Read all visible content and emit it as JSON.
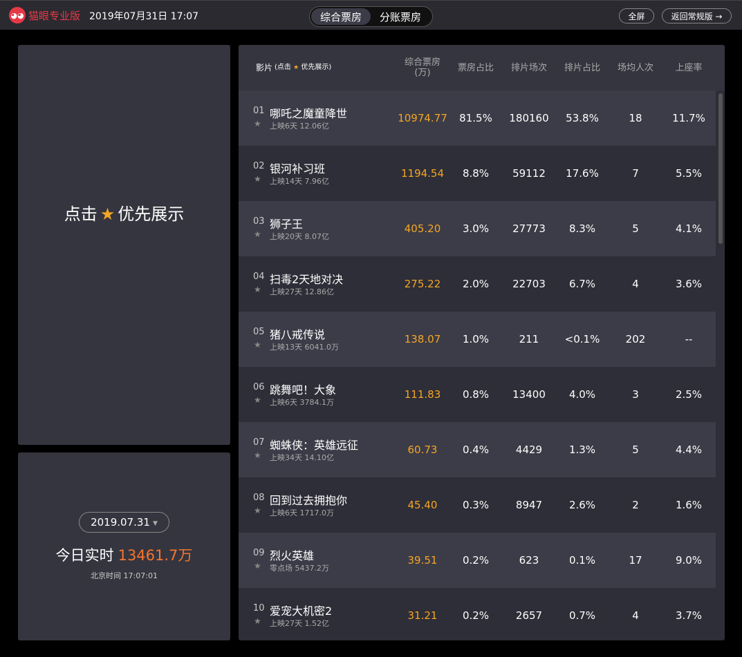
{
  "topbar": {
    "logo_text": "猫眼专业版",
    "datetime": "2019年07月31日 17:07",
    "tabs": [
      {
        "label": "综合票房",
        "active": true
      },
      {
        "label": "分账票房",
        "active": false
      }
    ],
    "fullscreen_label": "全屏",
    "return_label": "返回常规版 →"
  },
  "priority_panel": {
    "prefix": "点击",
    "suffix": "优先展示"
  },
  "summary": {
    "date": "2019.07.31",
    "today_label": "今日实时",
    "today_amount": "13461.7万",
    "beijing_time": "北京时间 17:07:01"
  },
  "table": {
    "headers": {
      "film": "影片",
      "film_hint_prefix": "(点击",
      "film_hint_suffix": "优先展示)",
      "box_line1": "综合票房",
      "box_line2": "(万)",
      "box_share": "票房占比",
      "shows": "排片场次",
      "show_share": "排片占比",
      "avg_viewers": "场均人次",
      "occupancy": "上座率"
    },
    "rows": [
      {
        "rank": "01",
        "name": "哪吒之魔童降世",
        "meta": "上映6天  12.06亿",
        "box": "10974.77",
        "box_share": "81.5%",
        "shows": "180160",
        "show_share": "53.8%",
        "avg": "18",
        "occ": "11.7%"
      },
      {
        "rank": "02",
        "name": "银河补习班",
        "meta": "上映14天  7.96亿",
        "box": "1194.54",
        "box_share": "8.8%",
        "shows": "59112",
        "show_share": "17.6%",
        "avg": "7",
        "occ": "5.5%"
      },
      {
        "rank": "03",
        "name": "狮子王",
        "meta": "上映20天  8.07亿",
        "box": "405.20",
        "box_share": "3.0%",
        "shows": "27773",
        "show_share": "8.3%",
        "avg": "5",
        "occ": "4.1%"
      },
      {
        "rank": "04",
        "name": "扫毒2天地对决",
        "meta": "上映27天  12.86亿",
        "box": "275.22",
        "box_share": "2.0%",
        "shows": "22703",
        "show_share": "6.7%",
        "avg": "4",
        "occ": "3.6%"
      },
      {
        "rank": "05",
        "name": "猪八戒传说",
        "meta": "上映13天  6041.0万",
        "box": "138.07",
        "box_share": "1.0%",
        "shows": "211",
        "show_share": "<0.1%",
        "avg": "202",
        "occ": "--"
      },
      {
        "rank": "06",
        "name": "跳舞吧！大象",
        "meta": "上映6天  3784.1万",
        "box": "111.83",
        "box_share": "0.8%",
        "shows": "13400",
        "show_share": "4.0%",
        "avg": "3",
        "occ": "2.5%"
      },
      {
        "rank": "07",
        "name": "蜘蛛侠：英雄远征",
        "meta": "上映34天  14.10亿",
        "box": "60.73",
        "box_share": "0.4%",
        "shows": "4429",
        "show_share": "1.3%",
        "avg": "5",
        "occ": "4.4%"
      },
      {
        "rank": "08",
        "name": "回到过去拥抱你",
        "meta": "上映6天  1717.0万",
        "box": "45.40",
        "box_share": "0.3%",
        "shows": "8947",
        "show_share": "2.6%",
        "avg": "2",
        "occ": "1.6%"
      },
      {
        "rank": "09",
        "name": "烈火英雄",
        "meta": "零点场  5437.2万",
        "box": "39.51",
        "box_share": "0.2%",
        "shows": "623",
        "show_share": "0.1%",
        "avg": "17",
        "occ": "9.0%"
      },
      {
        "rank": "10",
        "name": "爱宠大机密2",
        "meta": "上映27天  1.52亿",
        "box": "31.21",
        "box_share": "0.2%",
        "shows": "2657",
        "show_share": "0.7%",
        "avg": "4",
        "occ": "3.7%"
      }
    ]
  }
}
